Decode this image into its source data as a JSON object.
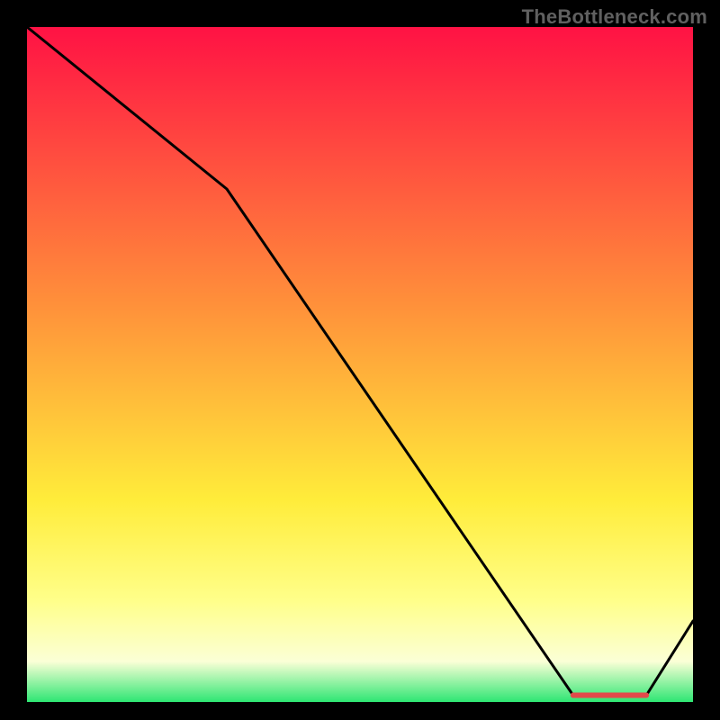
{
  "watermark": "TheBottleneck.com",
  "colors": {
    "top": "#ff1244",
    "mid1": "#ff933a",
    "mid2": "#ffec3a",
    "mid3": "#ffff8a",
    "mid4": "#fbffd6",
    "bottom": "#2ee673",
    "line": "#000000",
    "marker": "#e24a4a",
    "frame": "#000000"
  },
  "chart_data": {
    "type": "line",
    "title": "",
    "xlabel": "",
    "ylabel": "",
    "xlim": [
      0,
      100
    ],
    "ylim": [
      0,
      100
    ],
    "x": [
      0,
      30,
      82,
      93,
      100
    ],
    "values": [
      100,
      76,
      1,
      1,
      12
    ],
    "marker_segment": {
      "x0": 82,
      "x1": 93,
      "y": 1
    },
    "notes": "Curve drawn over a vertical heat-gradient background; x and y axes have no visible tick labels, so values are normalized 0–100. Line starts at top-left (y≈100), bends slightly near x≈30, descends almost linearly to a flat minimum around x≈82–93 at y≈1, marked by a short red segment, then rises to y≈12 at the right edge."
  }
}
